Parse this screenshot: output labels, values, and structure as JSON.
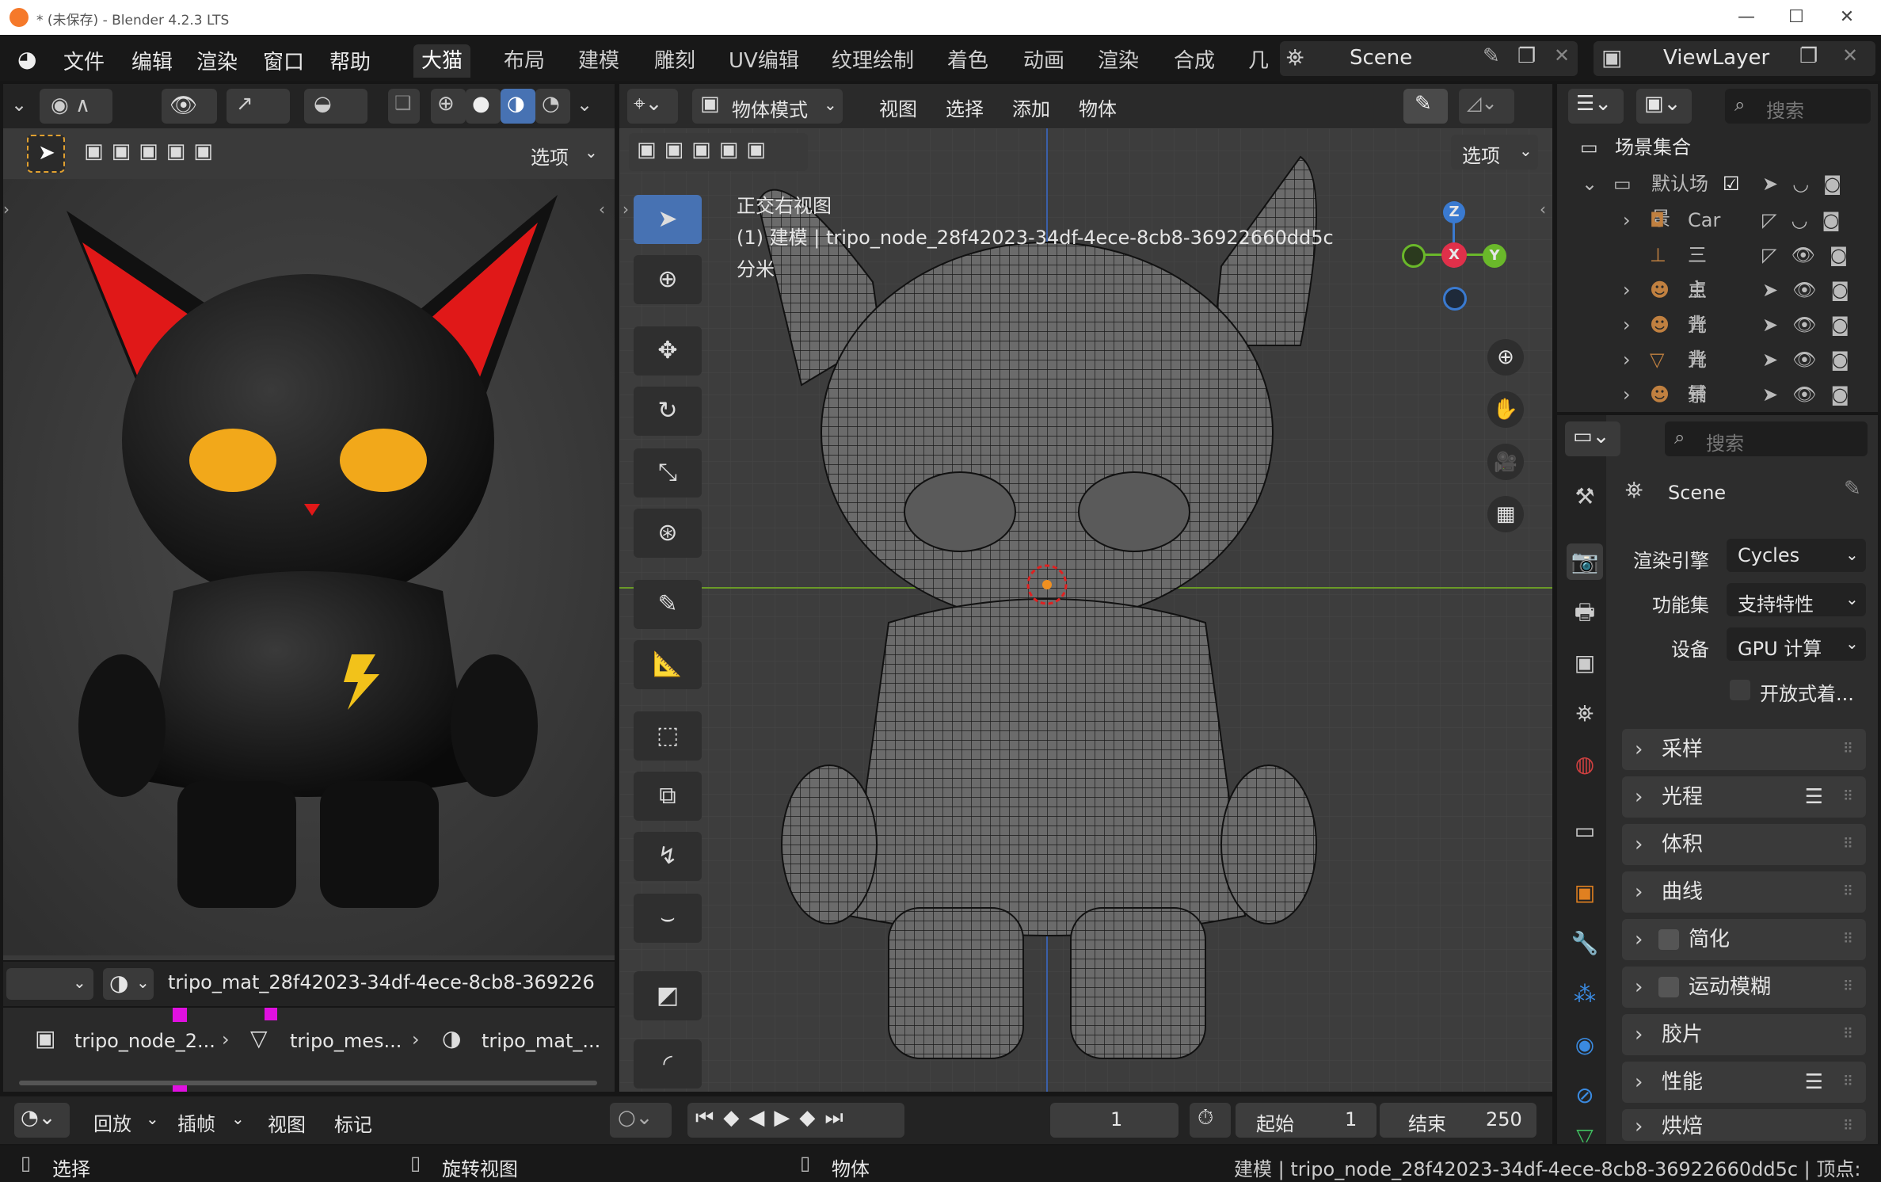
{
  "window": {
    "title": "* (未保存) - Blender 4.2.3 LTS",
    "minimize": "—",
    "maximize": "☐",
    "close": "✕"
  },
  "menu": {
    "items": [
      "文件",
      "编辑",
      "渲染",
      "窗口",
      "帮助"
    ]
  },
  "workspaces": [
    "大猫",
    "布局",
    "建模",
    "雕刻",
    "UV编辑",
    "纹理绘制",
    "着色",
    "动画",
    "渲染",
    "合成",
    "几"
  ],
  "scene": {
    "name": "Scene"
  },
  "view_layer": {
    "name": "ViewLayer"
  },
  "left_viewport": {
    "options": "选项"
  },
  "main_viewport": {
    "mode": "物体模式",
    "menus": [
      "视图",
      "选择",
      "添加",
      "物体"
    ],
    "options": "选项",
    "overlay_lines": [
      "正交右视图",
      "(1) 建模 | tripo_node_28f42023-34df-4ece-8cb8-36922660dd5c",
      "分米"
    ],
    "gizmo": {
      "z": "Z",
      "x": "X",
      "y": "Y"
    }
  },
  "material_bar": {
    "material": "tripo_mat_28f42023-34df-4ece-8cb8-369226"
  },
  "breadcrumb": {
    "node": "tripo_node_2...",
    "mesh": "tripo_mes...",
    "mat": "tripo_mat_..."
  },
  "outliner": {
    "search_placeholder": "搜索",
    "root": "场景集合",
    "rows": [
      "默认场景",
      "Car",
      "三点",
      "主光",
      "背光",
      "背景",
      "辅光"
    ]
  },
  "properties": {
    "search_placeholder": "搜索",
    "scene": "Scene",
    "render_engine_label": "渲染引擎",
    "render_engine": "Cycles",
    "feature_set_label": "功能集",
    "feature_set": "支持特性",
    "device_label": "设备",
    "device": "GPU 计算",
    "osl": "开放式着...",
    "panels": [
      "采样",
      "光程",
      "体积",
      "曲线",
      "简化",
      "运动模糊",
      "胶片",
      "性能",
      "烘焙"
    ]
  },
  "timeline": {
    "playback": "回放",
    "keying": "插帧",
    "view": "视图",
    "marker": "标记",
    "current_frame": "1",
    "start_label": "起始",
    "start": "1",
    "end_label": "结束",
    "end": "250"
  },
  "status": {
    "select": "选择",
    "rotate": "旋转视图",
    "object": "物体",
    "info": "建模 | tripo_node_28f42023-34df-4ece-8cb8-36922660dd5c | 顶点:"
  }
}
